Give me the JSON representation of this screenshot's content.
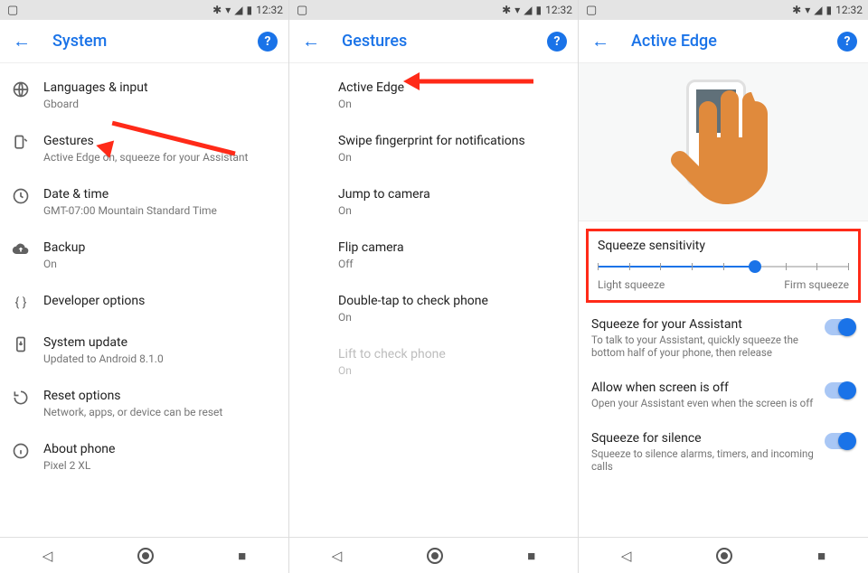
{
  "status": {
    "time": "12:32"
  },
  "panel1": {
    "title": "System",
    "items": [
      {
        "title": "Languages & input",
        "sub": "Gboard"
      },
      {
        "title": "Gestures",
        "sub": "Active Edge on, squeeze for your Assistant"
      },
      {
        "title": "Date & time",
        "sub": "GMT-07:00 Mountain Standard Time"
      },
      {
        "title": "Backup",
        "sub": "On"
      },
      {
        "title": "Developer options",
        "sub": ""
      },
      {
        "title": "System update",
        "sub": "Updated to Android 8.1.0"
      },
      {
        "title": "Reset options",
        "sub": "Network, apps, or device can be reset"
      },
      {
        "title": "About phone",
        "sub": "Pixel 2 XL"
      }
    ]
  },
  "panel2": {
    "title": "Gestures",
    "items": [
      {
        "title": "Active Edge",
        "sub": "On"
      },
      {
        "title": "Swipe fingerprint for notifications",
        "sub": "On"
      },
      {
        "title": "Jump to camera",
        "sub": "On"
      },
      {
        "title": "Flip camera",
        "sub": "Off"
      },
      {
        "title": "Double-tap to check phone",
        "sub": "On"
      },
      {
        "title": "Lift to check phone",
        "sub": "On",
        "disabled": true
      }
    ]
  },
  "panel3": {
    "title": "Active Edge",
    "sensitivity": {
      "title": "Squeeze sensitivity",
      "min_label": "Light squeeze",
      "max_label": "Firm squeeze",
      "ticks": 9,
      "value_index": 5
    },
    "settings": [
      {
        "title": "Squeeze for your Assistant",
        "sub": "To talk to your Assistant, quickly squeeze the bottom half of your phone, then release",
        "on": true
      },
      {
        "title": "Allow when screen is off",
        "sub": "Open your Assistant even when the screen is off",
        "on": true
      },
      {
        "title": "Squeeze for silence",
        "sub": "Squeeze to silence alarms, timers, and incoming calls",
        "on": true
      }
    ]
  }
}
